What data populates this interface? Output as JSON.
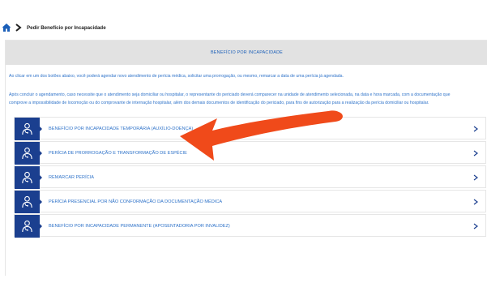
{
  "breadcrumb": {
    "label": "Pedir Benefício por Incapacidade"
  },
  "panel": {
    "title": "BENEFÍCIO POR INCAPACIDADE",
    "intro": "Ao clicar em um dos botões abaixo, você poderá agendar novo atendimento de perícia médica, solicitar uma prorrogação, ou mesmo, remarcar a data de uma perícia já agendada.",
    "paragraph_line1": "Após concluir o agendamento, caso necessite que o atendimento seja domiciliar ou hospitalar, o representante do periciado deverá comparecer na unidade de atendimento selecionada, na data e hora marcada, com a documentação que",
    "paragraph_line2": "comprove a impossibilidade de locomoção ou do comprovante de internação hospitalar, além dos demais documentos de identificação do periciado, para fins de autorização para a realização da perícia domiciliar ou hospitalar."
  },
  "items": [
    {
      "label": "BENEFÍCIO POR INCAPACIDADE TEMPORÁRIA (AUXÍLIO-DOENÇA)"
    },
    {
      "label": "PERÍCIA DE PRORROGAÇÃO E TRANSFORMAÇÃO DE ESPÉCIE"
    },
    {
      "label": "REMARCAR PERÍCIA"
    },
    {
      "label": "PERÍCIA PRESENCIAL POR NÃO CONFORMAÇÃO DA DOCUMENTAÇÃO MÉDICA"
    },
    {
      "label": "BENEFÍCIO POR INCAPACIDADE PERMANENTE (APOSENTADORIA POR INVALIDEZ)"
    }
  ],
  "colors": {
    "tile": "#1b3f8f",
    "link_text": "#2f73c9",
    "header_bg": "#e2e2e2",
    "annotation_arrow": "#f04a1a"
  }
}
